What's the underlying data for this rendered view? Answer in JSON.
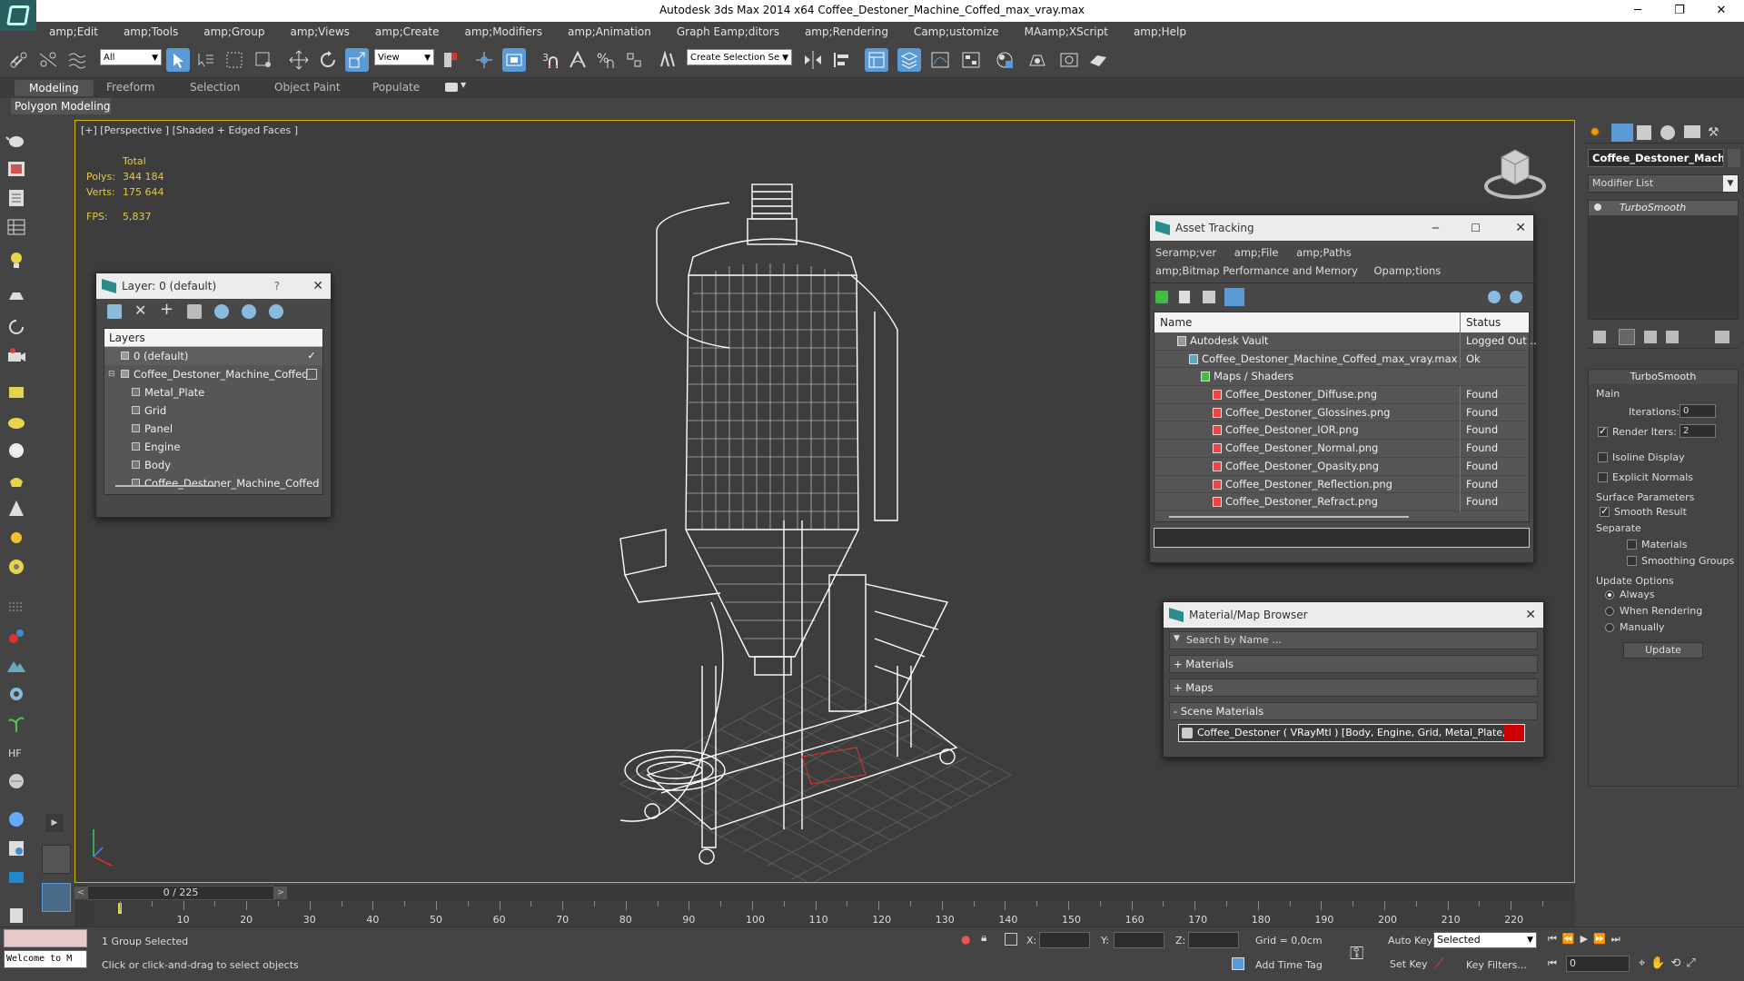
{
  "window": {
    "title": "Autodesk 3ds Max  2014 x64    Coffee_Destoner_Machine_Coffed_max_vray.max",
    "minimize": "─",
    "maximize": "❐",
    "close": "✕"
  },
  "menu": [
    "amp;Edit",
    "amp;Tools",
    "amp;Group",
    "amp;Views",
    "amp;Create",
    "amp;Modifiers",
    "amp;Animation",
    "Graph Eamp;ditors",
    "amp;Rendering",
    "Camp;ustomize",
    "MAamp;XScript",
    "amp;Help"
  ],
  "toolbar": {
    "selection_filter": "All",
    "reference_coord": "View",
    "named_selection_placeholder": "Create Selection Se"
  },
  "ribbon": {
    "tabs": [
      "Modeling",
      "Freeform",
      "Selection",
      "Object Paint",
      "Populate"
    ],
    "sub_label": "Polygon Modeling"
  },
  "viewport": {
    "label": "[+] [Perspective ] [Shaded + Edged Faces ]",
    "stats": {
      "total_label": "Total",
      "polys_label": "Polys:",
      "polys_value": "344 184",
      "verts_label": "Verts:",
      "verts_value": "175 644",
      "fps_label": "FPS:",
      "fps_value": "5,837"
    }
  },
  "layer_window": {
    "title": "Layer: 0 (default)",
    "help": "?",
    "close": "✕",
    "header": "Layers",
    "rows": [
      {
        "name": "0 (default)",
        "indent": 0
      },
      {
        "name": "Coffee_Destoner_Machine_Coffed",
        "indent": 0
      },
      {
        "name": "Metal_Plate",
        "indent": 1
      },
      {
        "name": "Grid",
        "indent": 1
      },
      {
        "name": "Panel",
        "indent": 1
      },
      {
        "name": "Engine",
        "indent": 1
      },
      {
        "name": "Body",
        "indent": 1
      },
      {
        "name": "Coffee_Destoner_Machine_Coffed",
        "indent": 1
      }
    ]
  },
  "asset_window": {
    "title": "Asset Tracking",
    "menu_row1": [
      "Seramp;ver",
      "amp;File",
      "amp;Paths"
    ],
    "menu_row2": [
      "amp;Bitmap Performance and Memory",
      "Opamp;tions"
    ],
    "col_name": "Name",
    "col_status": "Status",
    "rows": [
      {
        "name": "Autodesk Vault",
        "status": "Logged Out ..",
        "indent": 1
      },
      {
        "name": "Coffee_Destoner_Machine_Coffed_max_vray.max",
        "status": "Ok",
        "indent": 2
      },
      {
        "name": "Maps / Shaders",
        "status": "",
        "indent": 3
      },
      {
        "name": "Coffee_Destoner_Diffuse.png",
        "status": "Found",
        "indent": 4
      },
      {
        "name": "Coffee_Destoner_Glossines.png",
        "status": "Found",
        "indent": 4
      },
      {
        "name": "Coffee_Destoner_IOR.png",
        "status": "Found",
        "indent": 4
      },
      {
        "name": "Coffee_Destoner_Normal.png",
        "status": "Found",
        "indent": 4
      },
      {
        "name": "Coffee_Destoner_Opasity.png",
        "status": "Found",
        "indent": 4
      },
      {
        "name": "Coffee_Destoner_Reflection.png",
        "status": "Found",
        "indent": 4
      },
      {
        "name": "Coffee_Destoner_Refract.png",
        "status": "Found",
        "indent": 4
      }
    ]
  },
  "material_window": {
    "title": "Material/Map Browser",
    "close": "✕",
    "search_placeholder": "Search by Name ...",
    "sections": [
      "+ Materials",
      "+ Maps",
      "- Scene Materials"
    ],
    "scene_material": "Coffee_Destoner  ( VRayMtl )  [Body, Engine, Grid, Metal_Plate, Panel]"
  },
  "command_panel": {
    "object_name": "Coffee_Destoner_Machin",
    "modifier_list": "Modifier List",
    "stack_item": "TurboSmooth",
    "rollout_title": "TurboSmooth",
    "main_label": "Main",
    "iterations_label": "Iterations:",
    "iterations_value": "0",
    "render_iters_label": "Render Iters:",
    "render_iters_value": "2",
    "isoline_label": "Isoline Display",
    "explicit_normals_label": "Explicit Normals",
    "surface_params_label": "Surface Parameters",
    "smooth_result_label": "Smooth Result",
    "separate_label": "Separate",
    "materials_label": "Materials",
    "smoothing_groups_label": "Smoothing Groups",
    "update_options_label": "Update Options",
    "always_label": "Always",
    "when_rendering_label": "When Rendering",
    "manually_label": "Manually",
    "update_button": "Update"
  },
  "timeline": {
    "frame_counter": "0 / 225",
    "ticks": [
      "10",
      "20",
      "30",
      "40",
      "50",
      "60",
      "70",
      "80",
      "90",
      "100",
      "110",
      "120",
      "130",
      "140",
      "150",
      "160",
      "170",
      "180",
      "190",
      "200",
      "210",
      "220"
    ]
  },
  "status": {
    "listener": "Welcome to M",
    "selection": "1 Group Selected",
    "prompt": "Click or click-and-drag to select objects",
    "x_label": "X:",
    "y_label": "Y:",
    "z_label": "Z:",
    "grid": "Grid = 0,0cm",
    "add_time_tag": "Add Time Tag",
    "auto_key": "Auto Key",
    "set_key": "Set Key",
    "selected_dropdown": "Selected",
    "key_filters": "Key Filters...",
    "frame_value": "0"
  }
}
